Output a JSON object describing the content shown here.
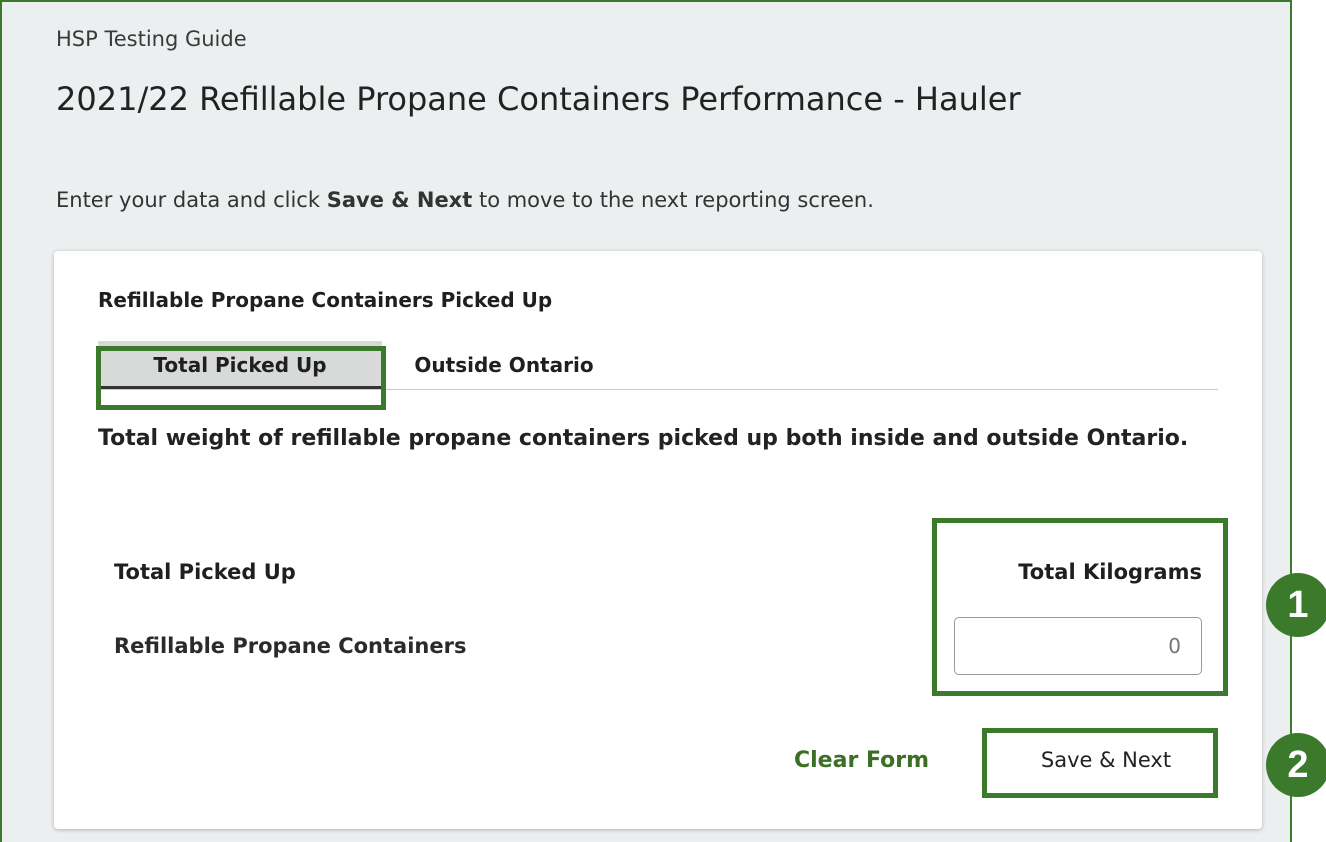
{
  "header": {
    "guide_label": "HSP Testing Guide",
    "title": "2021/22 Refillable Propane Containers Performance - Hauler",
    "instructions_prefix": "Enter your data and click ",
    "instructions_bold": "Save & Next",
    "instructions_suffix": " to move to the next reporting screen."
  },
  "card": {
    "title": "Refillable Propane Containers Picked Up",
    "tabs": [
      {
        "label": "Total Picked Up",
        "active": true
      },
      {
        "label": "Outside Ontario",
        "active": false
      }
    ],
    "description": "Total weight of refillable propane containers picked up both inside and outside Ontario.",
    "table": {
      "row_header": "Total Picked Up",
      "column_header": "Total Kilograms",
      "rows": [
        {
          "label": "Refillable Propane Containers",
          "value": "",
          "placeholder": "0"
        }
      ]
    },
    "actions": {
      "clear_label": "Clear Form",
      "save_label": "Save & Next"
    }
  },
  "callouts": [
    "1",
    "2"
  ],
  "colors": {
    "accent_green": "#3b7a2a",
    "link_green": "#3b6f24",
    "page_background": "#eceff0"
  }
}
